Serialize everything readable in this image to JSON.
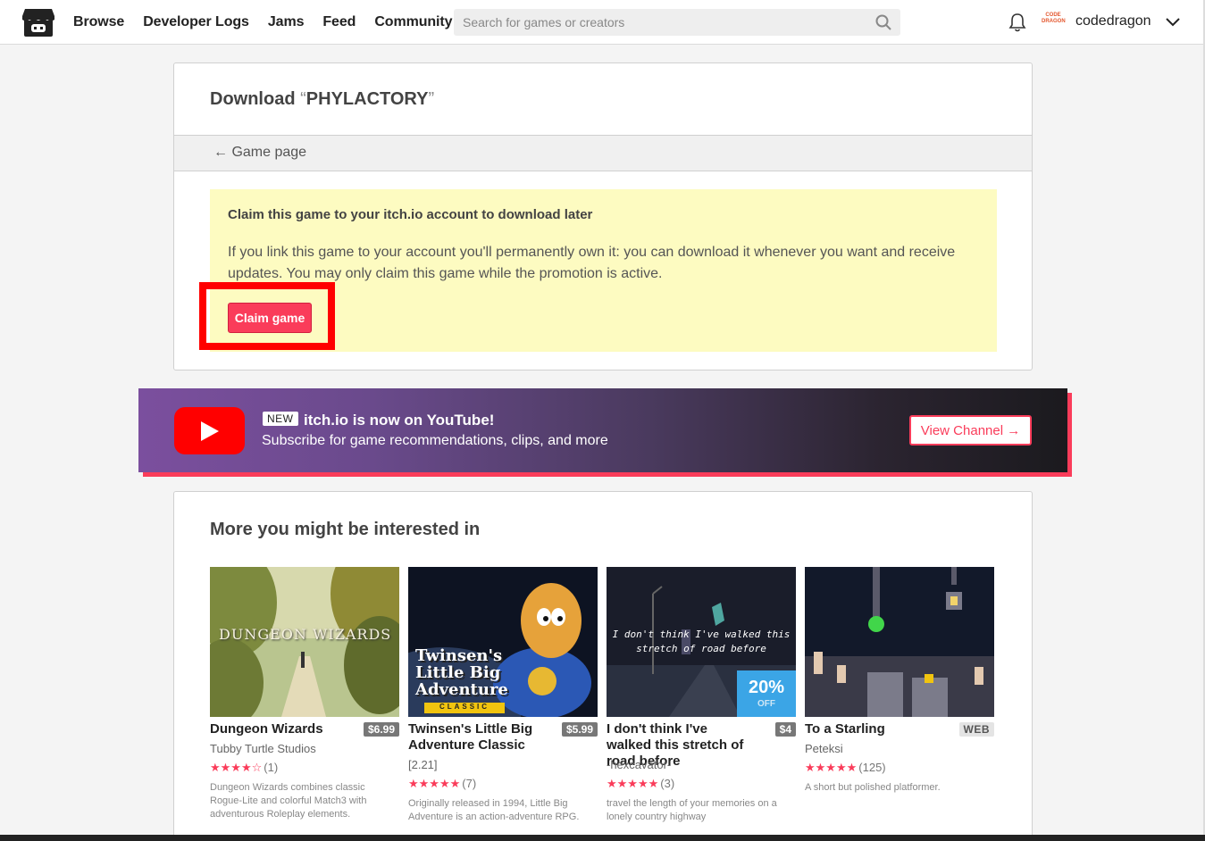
{
  "header": {
    "nav": [
      "Browse",
      "Developer Logs",
      "Jams",
      "Feed",
      "Community"
    ],
    "search_placeholder": "Search for games or creators",
    "avatar_text": "CODE DRAGON",
    "username": "codedragon"
  },
  "download": {
    "title_prefix": "Download ",
    "open_quote": "“",
    "game_name": "PHYLACTORY",
    "close_quote": "”",
    "back_link": "← Game page",
    "claim_title": "Claim this game to your itch.io account to download later",
    "claim_desc": "If you link this game to your account you'll permanently own it: you can download it whenever you want and receive updates. You may only claim this game while the promotion is active.",
    "claim_button": "Claim game"
  },
  "youtube": {
    "badge": "NEW",
    "headline": "itch.io is now on YouTube!",
    "subtitle": "Subscribe for game recommendations, clips, and more",
    "button": "View Channel →"
  },
  "recommendations": {
    "title": "More you might be interested in",
    "games": [
      {
        "title": "Dungeon Wizards",
        "price": "$6.99",
        "author": "Tubby Turtle Studios",
        "stars": "★★★★☆",
        "count": "(1)",
        "desc": "Dungeon Wizards combines classic Rogue-Lite and colorful Match3 with adventurous Roleplay elements.",
        "art_text": "DUNGEON WIZARDS"
      },
      {
        "title": "Twinsen's Little Big Adventure Classic",
        "price": "$5.99",
        "author": "[2.21]",
        "stars": "★★★★★",
        "count": "(7)",
        "desc": "Originally released in 1994, Little Big Adventure is an action-adventure RPG.",
        "art_text": "Twinsen's Little Big Adventure",
        "art_sub": "CLASSIC"
      },
      {
        "title": "I don't think I've walked this stretch of road before",
        "price": "$4",
        "author": "-hexcavator-",
        "stars": "★★★★★",
        "count": "(3)",
        "desc": "travel the length of your memories on a lonely country highway",
        "art_text": "I don't think I've walked this stretch of road before",
        "discount_pct": "20%",
        "discount_off": "OFF"
      },
      {
        "title": "To a Starling",
        "price": "WEB",
        "author": "Peteksi",
        "stars": "★★★★★",
        "count": "(125)",
        "desc": "A short but polished platformer."
      }
    ]
  }
}
